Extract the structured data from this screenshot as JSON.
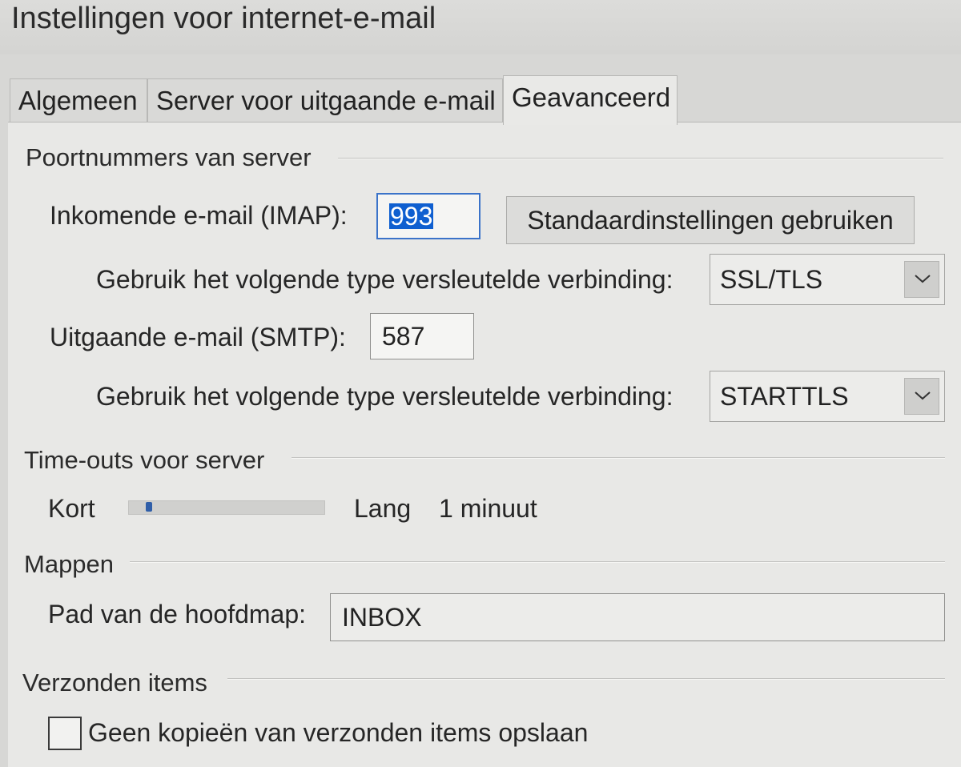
{
  "window": {
    "title": "Instellingen voor internet-e-mail"
  },
  "tabs": [
    {
      "label": "Algemeen",
      "active": false
    },
    {
      "label": "Server voor uitgaande e-mail",
      "active": false
    },
    {
      "label": "Geavanceerd",
      "active": true
    }
  ],
  "server_ports": {
    "group_label": "Poortnummers van server",
    "incoming_label": "Inkomende e-mail (IMAP):",
    "incoming_value": "993",
    "defaults_button": "Standaardinstellingen gebruiken",
    "incoming_encryption_label": "Gebruik het volgende type versleutelde verbinding:",
    "incoming_encryption_value": "SSL/TLS",
    "outgoing_label": "Uitgaande e-mail (SMTP):",
    "outgoing_value": "587",
    "outgoing_encryption_label": "Gebruik het volgende type versleutelde verbinding:",
    "outgoing_encryption_value": "STARTTLS"
  },
  "timeouts": {
    "group_label": "Time-outs voor server",
    "short_label": "Kort",
    "long_label": "Lang",
    "value_text": "1 minuut",
    "slider_fraction": 0.09
  },
  "folders": {
    "group_label": "Mappen",
    "root_path_label": "Pad van de hoofdmap:",
    "root_path_value": "INBOX"
  },
  "sent_items": {
    "group_label": "Verzonden items",
    "checkbox_label": "Geen kopieën van verzonden items opslaan",
    "checked": false
  },
  "colors": {
    "accent": "#3b73c9",
    "selection": "#0f5fd0"
  },
  "icons": {
    "dropdown": "chevron-down-icon"
  }
}
